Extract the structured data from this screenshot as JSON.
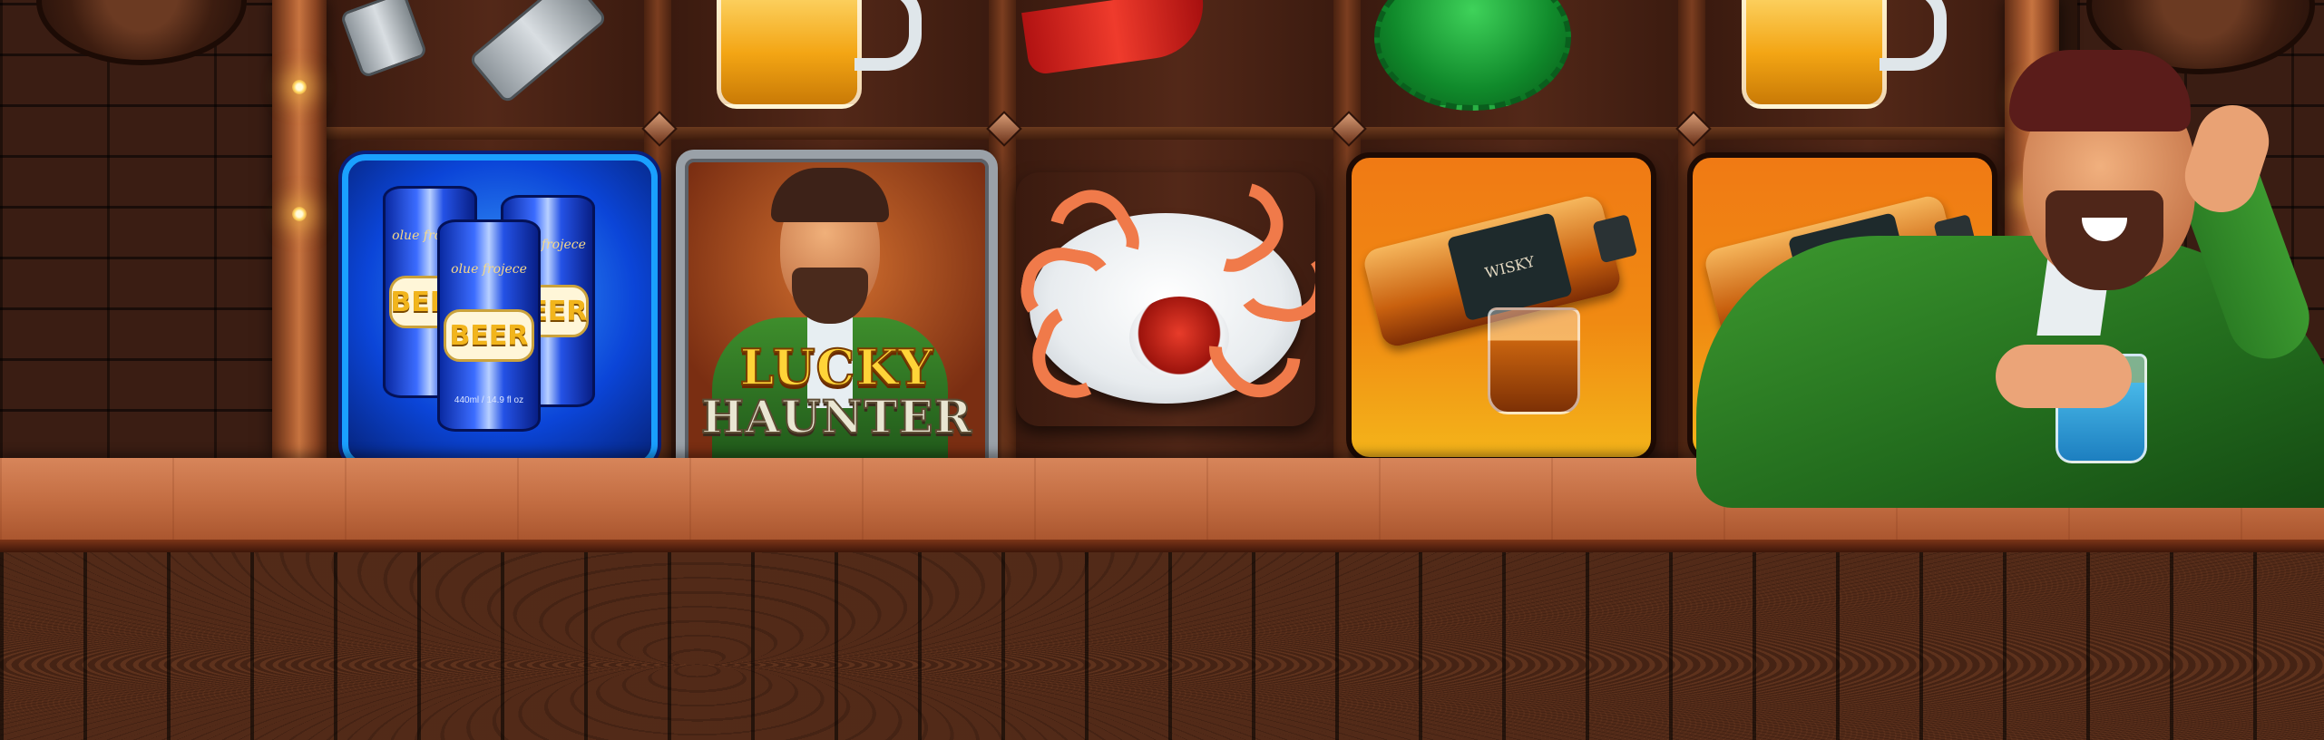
{
  "game": {
    "reels": [
      {
        "id": 1,
        "top_symbol": "bottle-opener",
        "main_symbol": "beer-cans"
      },
      {
        "id": 2,
        "top_symbol": "beer-mug",
        "main_symbol": "lucky-haunter-wild"
      },
      {
        "id": 3,
        "top_symbol": "lobster",
        "main_symbol": "shrimp-plate"
      },
      {
        "id": 4,
        "top_symbol": "bottle-cap",
        "main_symbol": "whisky"
      },
      {
        "id": 5,
        "top_symbol": "beer-mug",
        "main_symbol": "whisky"
      }
    ],
    "symbols": {
      "beer": {
        "can_label": "BEER",
        "can_brand": "olue frojece",
        "can_volume": "440ml / 14.9 fl oz"
      },
      "wild": {
        "logo_line1": "LUCKY",
        "logo_line2": "HAUNTER"
      },
      "whisky": {
        "bottle_label": "WISKY"
      }
    }
  },
  "colors": {
    "beer_tile": "#0b45d8",
    "whisky_tile": "#f07a14",
    "wood": "#c26c41",
    "jacket": "#3d9a2f"
  }
}
